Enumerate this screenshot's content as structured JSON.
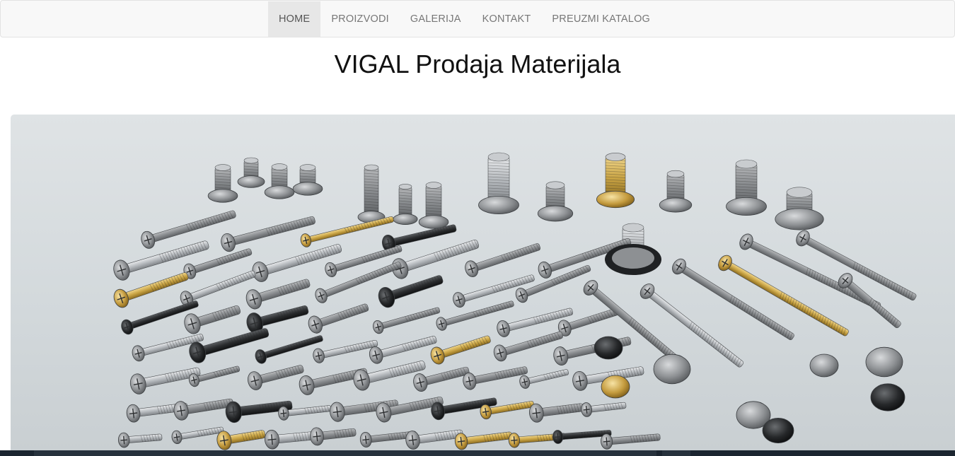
{
  "nav": {
    "items": [
      {
        "label": "HOME",
        "active": true
      },
      {
        "label": "PROIZVODI",
        "active": false
      },
      {
        "label": "GALERIJA",
        "active": false
      },
      {
        "label": "KONTAKT",
        "active": false
      },
      {
        "label": "PREUZMI KATALOG",
        "active": false
      }
    ]
  },
  "header": {
    "title": "VIGAL Prodaja Materijala"
  },
  "hero": {
    "subject": "assorted screws and bolts"
  },
  "colors": {
    "navbar_bg": "#f8f8f8",
    "nav_active_bg": "#e7e7e7",
    "nav_text": "#777777",
    "bottom_bar": "#1b2530"
  }
}
